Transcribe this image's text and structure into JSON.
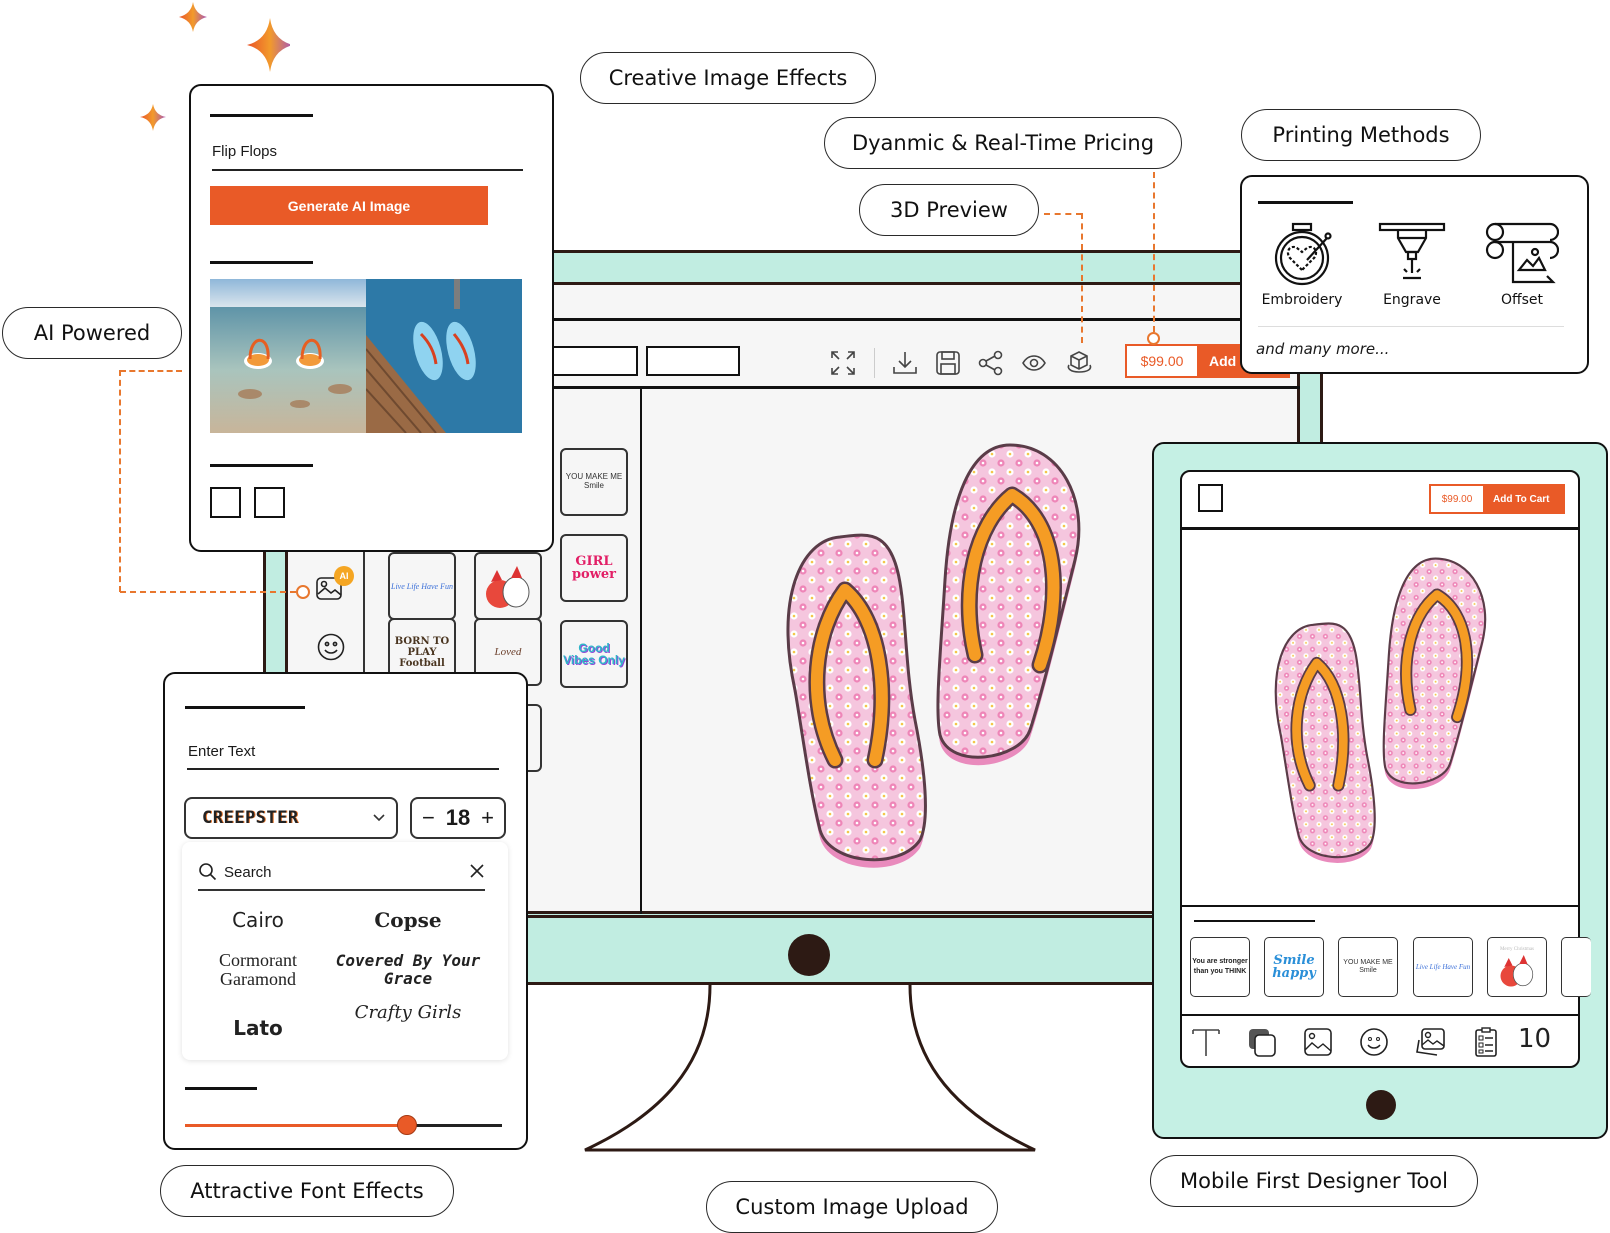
{
  "features": {
    "ai_powered": "AI Powered",
    "creative_effects": "Creative Image Effects",
    "dynamic_pricing": "Dyanmic & Real-Time Pricing",
    "preview_3d": "3D Preview",
    "printing_methods": "Printing Methods",
    "font_effects": "Attractive Font Effects",
    "image_upload": "Custom Image Upload",
    "mobile_first": "Mobile First Designer Tool"
  },
  "colors": {
    "accent": "#e95a27",
    "connector": "#e8772e",
    "bezel": "#c1ede1",
    "frame": "#2d1a14"
  },
  "desktop": {
    "toolbar": {
      "icons": [
        "fullscreen-icon",
        "download-icon",
        "save-icon",
        "share-icon",
        "preview-eye-icon",
        "3d-cube-icon"
      ],
      "price": "$99.00",
      "cart_label": "Add T"
    },
    "sidebar": {
      "icons": [
        "ai-image-icon",
        "emoji-icon"
      ],
      "ai_badge": "AI"
    },
    "thumbnails": [
      {
        "name": "you-make-me-smile",
        "text": "YOU MAKE ME Smile"
      },
      {
        "name": "live-life-have-fun",
        "text": "Live Life Have Fun"
      },
      {
        "name": "christmas-cats",
        "text": ""
      },
      {
        "name": "girl-power",
        "text": "GIRL power"
      },
      {
        "name": "born-to-play-football",
        "text": "BORN TO PLAY Football"
      },
      {
        "name": "loved-coffee",
        "text": "Loved"
      },
      {
        "name": "good-vibes-only",
        "text": "Good Vibes Only"
      }
    ]
  },
  "ai_panel": {
    "prompt_value": "Flip Flops",
    "generate_label": "Generate AI Image"
  },
  "printing_panel": {
    "methods": [
      {
        "label": "Embroidery",
        "icon": "embroidery-hoop-icon"
      },
      {
        "label": "Engrave",
        "icon": "laser-engrave-icon"
      },
      {
        "label": "Offset",
        "icon": "offset-print-icon"
      }
    ],
    "more": "and many more..."
  },
  "font_panel": {
    "text_placeholder": "Enter Text",
    "selected_font": "CREEPSTER",
    "size": "18",
    "minus": "−",
    "plus": "+",
    "search_placeholder": "Search",
    "fonts": [
      "Cairo",
      "Copse",
      "Cormorant Garamond",
      "Covered By Your Grace",
      "Lato",
      "Crafty Girls"
    ],
    "slider_value_pct": 70
  },
  "mobile": {
    "price": "$99.00",
    "cart_label": "Add To Cart",
    "thumbnails": [
      {
        "name": "you-are-stronger",
        "text": "You are stronger than you THINK"
      },
      {
        "name": "smile-be-happy",
        "text": "Smile happy"
      },
      {
        "name": "you-make-me-smile",
        "text": "YOU MAKE ME Smile"
      },
      {
        "name": "live-life-have-fun",
        "text": "Live Life Have Fun"
      },
      {
        "name": "merry-christmas-cats",
        "text": "Merry Christmas"
      }
    ],
    "tools": [
      "text-tool-icon",
      "layers-icon",
      "image-icon",
      "emoji-icon",
      "ai-image-icon",
      "clipboard-list-icon"
    ],
    "count": "10"
  }
}
